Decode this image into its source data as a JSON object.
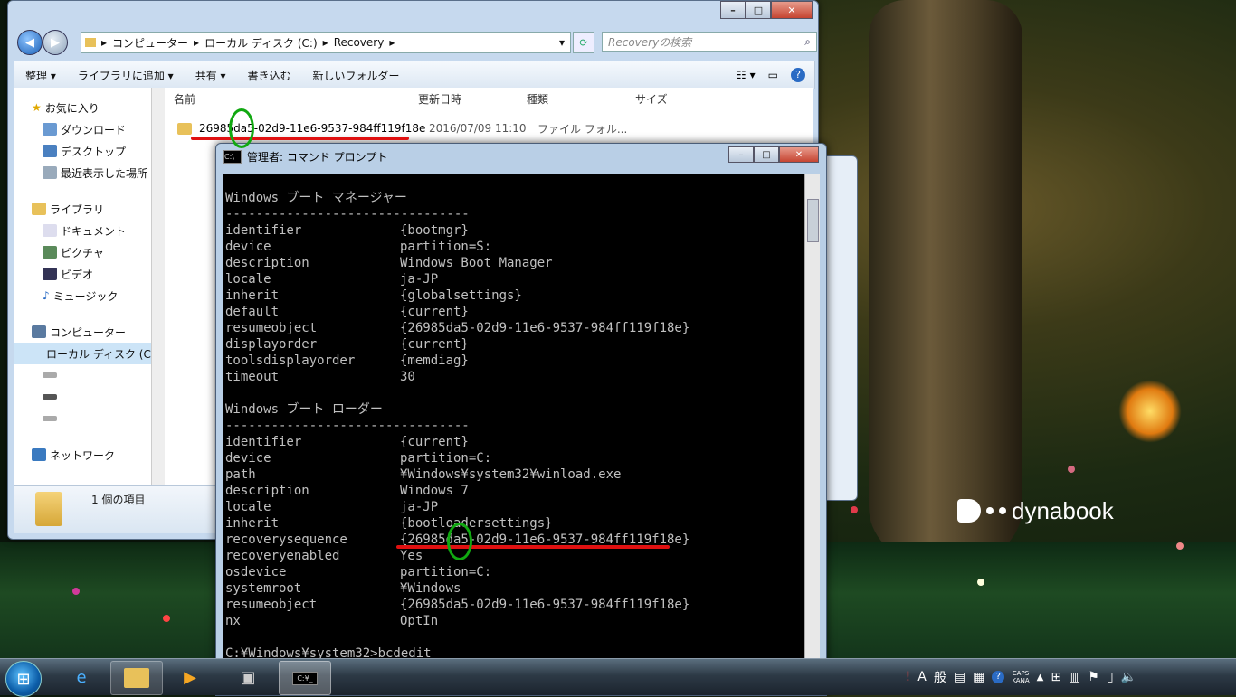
{
  "desktop": {
    "brand": "dynabook"
  },
  "explorer": {
    "breadcrumb": [
      "コンピューター",
      "ローカル ディスク (C:)",
      "Recovery"
    ],
    "search_placeholder": "Recoveryの検索",
    "toolbar": {
      "organize": "整理 ▾",
      "add_library": "ライブラリに追加 ▾",
      "share": "共有 ▾",
      "burn": "書き込む",
      "new_folder": "新しいフォルダー"
    },
    "nav": {
      "favorites": "お気に入り",
      "downloads": "ダウンロード",
      "desktop": "デスクトップ",
      "recent": "最近表示した場所",
      "libraries": "ライブラリ",
      "documents": "ドキュメント",
      "pictures": "ピクチャ",
      "videos": "ビデオ",
      "music": "ミュージック",
      "computer": "コンピューター",
      "local_disk": "ローカル ディスク (C:)",
      "network": "ネットワーク"
    },
    "columns": {
      "name": "名前",
      "modified": "更新日時",
      "type": "種類",
      "size": "サイズ"
    },
    "files": [
      {
        "name": "26985da5-02d9-11e6-9537-984ff119f18e",
        "modified": "2016/07/09 11:10",
        "type": "ファイル フォル..."
      }
    ],
    "status": "1 個の項目"
  },
  "cmd": {
    "title": "管理者: コマンド プロンプト",
    "bootmgr_header": "Windows ブート マネージャー",
    "separator": "--------------------------------",
    "bootmgr": [
      {
        "key": "identifier",
        "value": "{bootmgr}"
      },
      {
        "key": "device",
        "value": "partition=S:"
      },
      {
        "key": "description",
        "value": "Windows Boot Manager"
      },
      {
        "key": "locale",
        "value": "ja-JP"
      },
      {
        "key": "inherit",
        "value": "{globalsettings}"
      },
      {
        "key": "default",
        "value": "{current}"
      },
      {
        "key": "resumeobject",
        "value": "{26985da5-02d9-11e6-9537-984ff119f18e}"
      },
      {
        "key": "displayorder",
        "value": "{current}"
      },
      {
        "key": "toolsdisplayorder",
        "value": "{memdiag}"
      },
      {
        "key": "timeout",
        "value": "30"
      }
    ],
    "loader_header": "Windows ブート ローダー",
    "loader": [
      {
        "key": "identifier",
        "value": "{current}"
      },
      {
        "key": "device",
        "value": "partition=C:"
      },
      {
        "key": "path",
        "value": "¥Windows¥system32¥winload.exe"
      },
      {
        "key": "description",
        "value": "Windows 7"
      },
      {
        "key": "locale",
        "value": "ja-JP"
      },
      {
        "key": "inherit",
        "value": "{bootloadersettings}"
      },
      {
        "key": "recoverysequence",
        "value": "{26985da5-02d9-11e6-9537-984ff119f18e}"
      },
      {
        "key": "recoveryenabled",
        "value": "Yes"
      },
      {
        "key": "osdevice",
        "value": "partition=C:"
      },
      {
        "key": "systemroot",
        "value": "¥Windows"
      },
      {
        "key": "resumeobject",
        "value": "{26985da5-02d9-11e6-9537-984ff119f18e}"
      },
      {
        "key": "nx",
        "value": "OptIn"
      }
    ],
    "prompt": "C:¥Windows¥system32>bcdedit"
  },
  "taskbar": {
    "ime_a": "A",
    "ime_mode": "般",
    "caps": "CAPS",
    "kana": "KANA",
    "cmd_icon_text": "C:¥_"
  },
  "colors": {
    "annotation_red": "#e01010",
    "annotation_green": "#11a811"
  }
}
